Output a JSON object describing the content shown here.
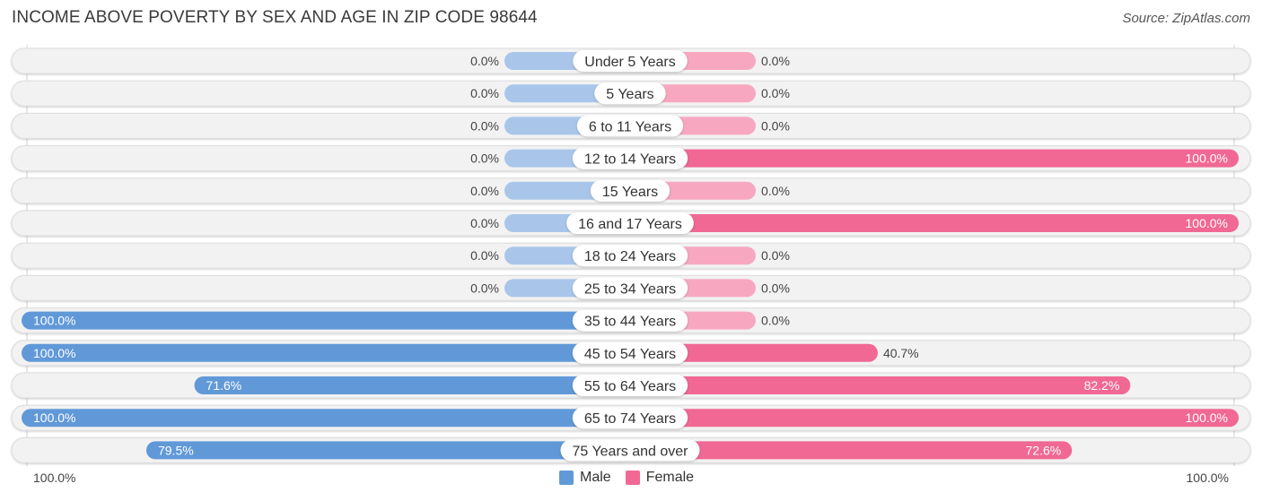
{
  "header": {
    "title": "INCOME ABOVE POVERTY BY SEX AND AGE IN ZIP CODE 98644",
    "source": "Source: ZipAtlas.com"
  },
  "colors": {
    "male": "#6199d8",
    "male_light": "#a9c6ea",
    "female": "#f06893",
    "female_light": "#f7a8c0",
    "track": "#f2f2f2"
  },
  "chart_data": {
    "type": "bar",
    "orientation": "horizontal-diverging",
    "title": "INCOME ABOVE POVERTY BY SEX AND AGE IN ZIP CODE 98644",
    "xlabel": "",
    "ylabel": "",
    "xlim": [
      -100,
      100
    ],
    "axis_tick_labels": {
      "left": "100.0%",
      "right": "100.0%"
    },
    "legend": {
      "position": "bottom-center",
      "entries": [
        "Male",
        "Female"
      ]
    },
    "categories": [
      "Under 5 Years",
      "5 Years",
      "6 to 11 Years",
      "12 to 14 Years",
      "15 Years",
      "16 and 17 Years",
      "18 to 24 Years",
      "25 to 34 Years",
      "35 to 44 Years",
      "45 to 54 Years",
      "55 to 64 Years",
      "65 to 74 Years",
      "75 Years and over"
    ],
    "series": [
      {
        "name": "Male",
        "values": [
          0.0,
          0.0,
          0.0,
          0.0,
          0.0,
          0.0,
          0.0,
          0.0,
          100.0,
          100.0,
          71.6,
          100.0,
          79.5
        ],
        "labels": [
          "0.0%",
          "0.0%",
          "0.0%",
          "0.0%",
          "0.0%",
          "0.0%",
          "0.0%",
          "0.0%",
          "100.0%",
          "100.0%",
          "71.6%",
          "100.0%",
          "79.5%"
        ]
      },
      {
        "name": "Female",
        "values": [
          0.0,
          0.0,
          0.0,
          100.0,
          0.0,
          100.0,
          0.0,
          0.0,
          0.0,
          40.7,
          82.2,
          100.0,
          72.6
        ],
        "labels": [
          "0.0%",
          "0.0%",
          "0.0%",
          "100.0%",
          "0.0%",
          "100.0%",
          "0.0%",
          "0.0%",
          "0.0%",
          "40.7%",
          "82.2%",
          "100.0%",
          "72.6%"
        ]
      }
    ]
  },
  "legend": {
    "male_label": "Male",
    "female_label": "Female"
  },
  "axis": {
    "left_label": "100.0%",
    "right_label": "100.0%"
  }
}
